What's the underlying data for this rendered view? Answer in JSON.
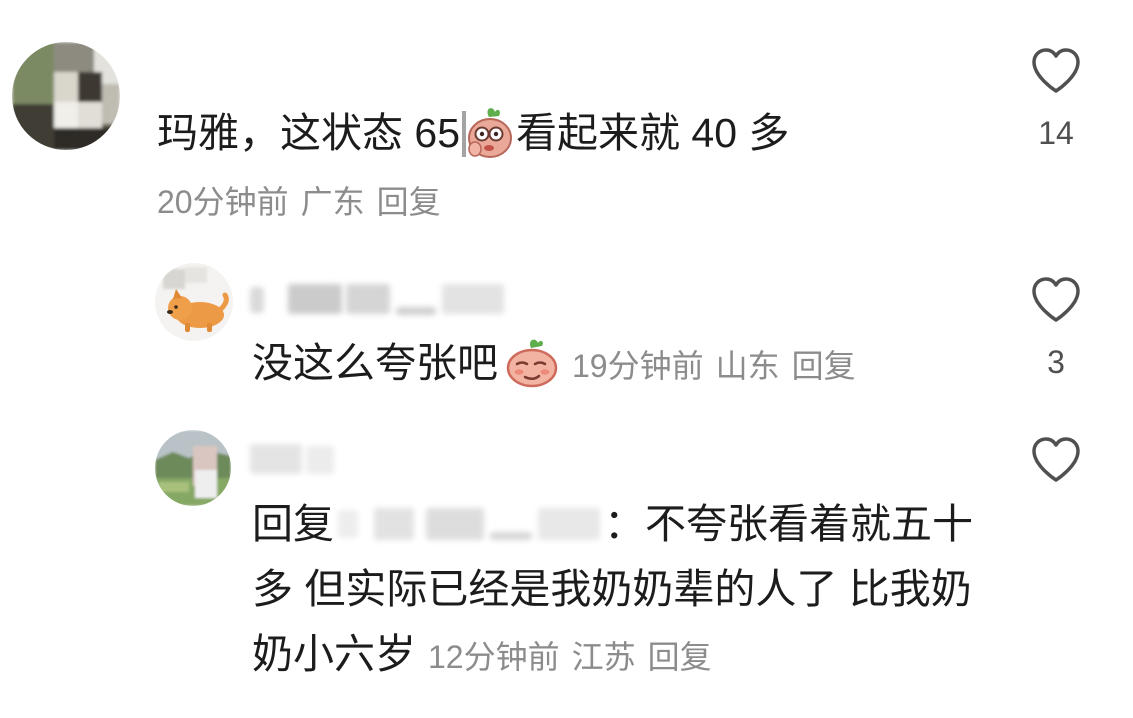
{
  "thread": {
    "comment": {
      "text_before": "玛雅，这状态 65",
      "text_after": "看起来就 40 多",
      "time": "20分钟前",
      "location": "广东",
      "reply_action": "回复",
      "like_count": "14"
    },
    "replies": [
      {
        "text": "没这么夸张吧",
        "time": "19分钟前",
        "location": "山东",
        "reply_action": "回复",
        "like_count": "3"
      },
      {
        "reply_prefix": "回复",
        "separator": "：",
        "text": "不夸张看着就五十多 但实际已经是我奶奶辈的人了 比我奶奶小六岁",
        "time": "12分钟前",
        "location": "江苏",
        "reply_action": "回复"
      }
    ]
  },
  "icons": {
    "like": "heart-outline-icon",
    "sticker_1": "peach-covering-face-sticker-icon",
    "sticker_2": "peach-smirk-sticker-icon"
  },
  "colors": {
    "background": "#ffffff",
    "text": "#1c1c1c",
    "meta": "#8c8c8c",
    "icon": "#505050"
  }
}
